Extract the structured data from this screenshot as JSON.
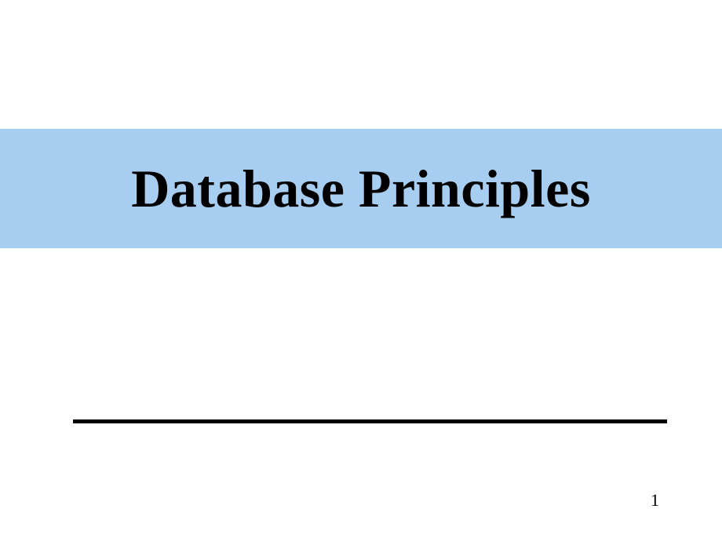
{
  "slide": {
    "title": "Database Principles",
    "page_number": "1"
  }
}
